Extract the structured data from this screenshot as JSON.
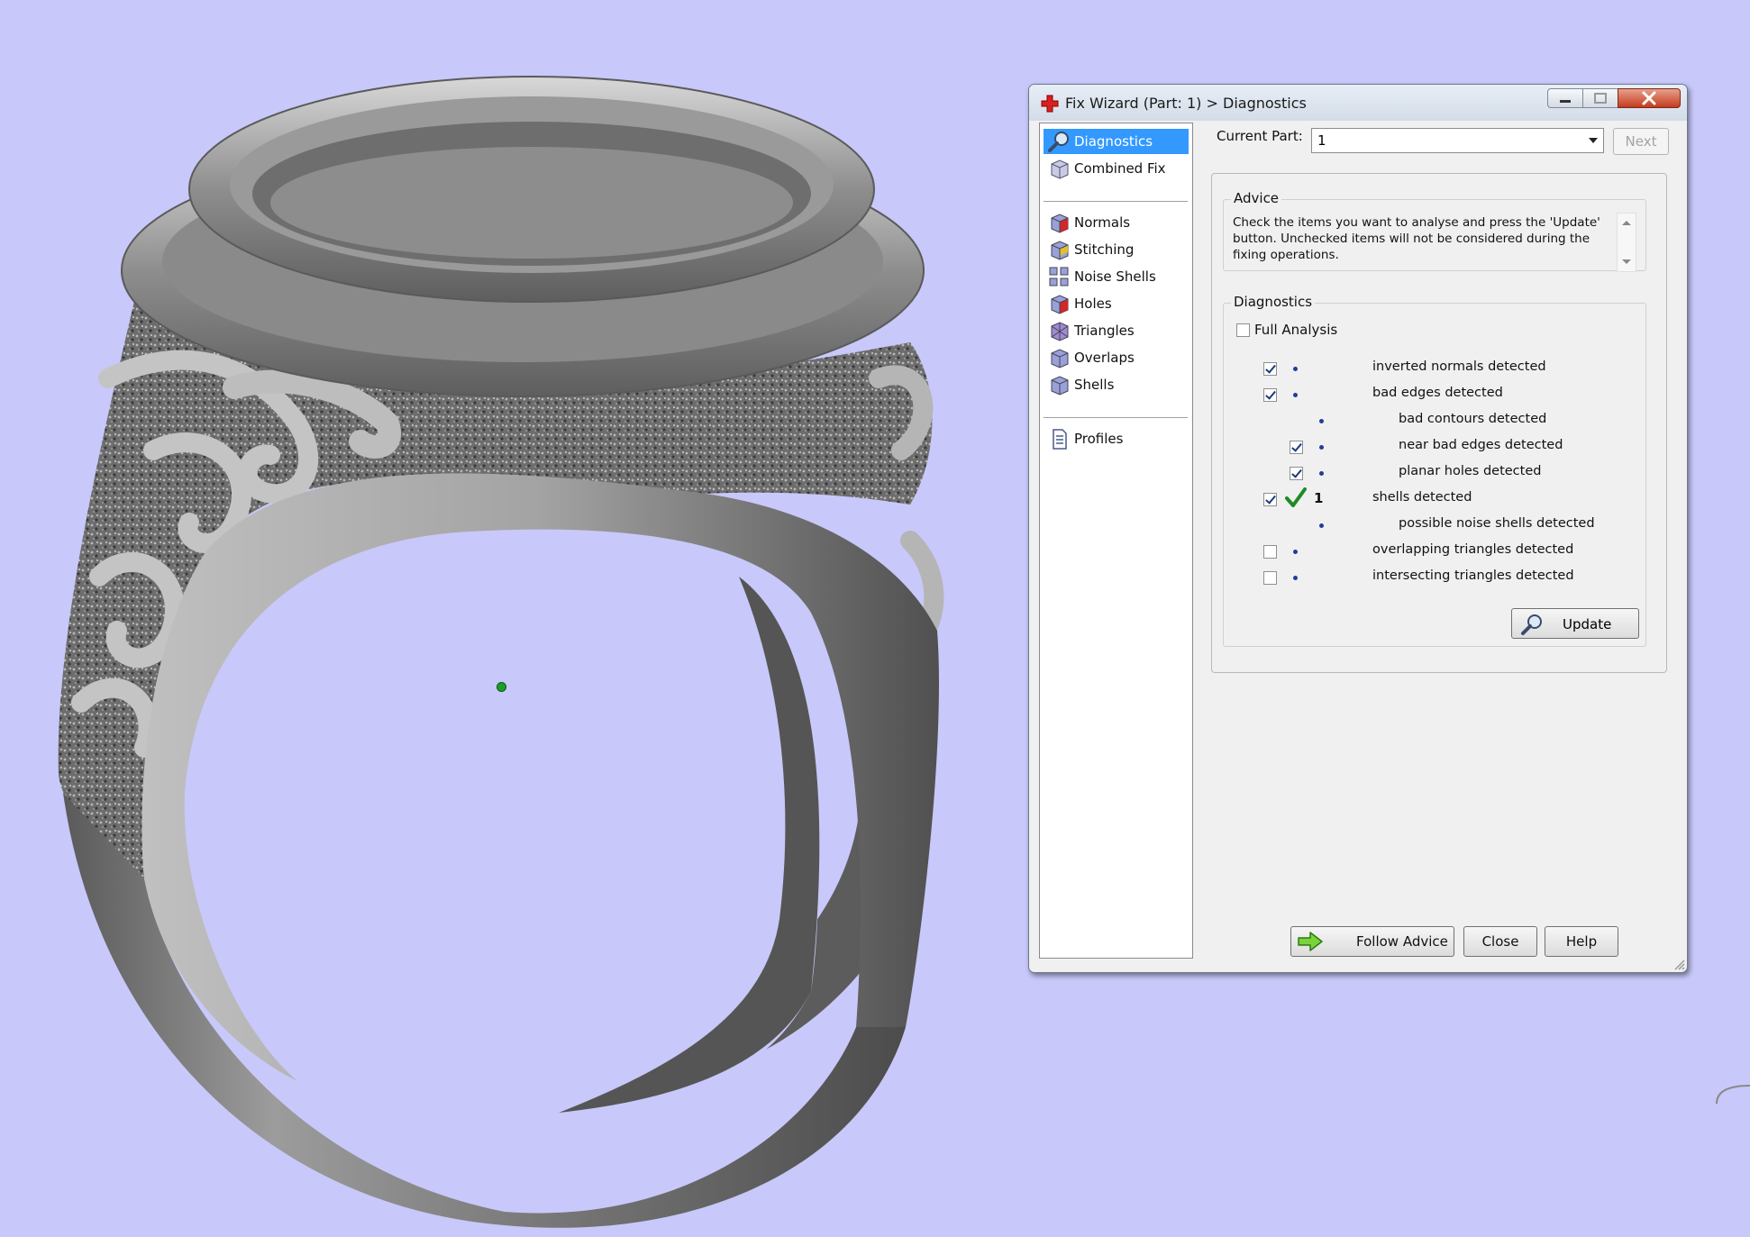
{
  "dialog": {
    "title": "Fix Wizard (Part: 1) > Diagnostics",
    "current_part_label": "Current Part:",
    "current_part_value": "1",
    "next_label": "Next"
  },
  "nav": {
    "items": [
      {
        "label": "Diagnostics",
        "selected": true,
        "icon": "magnifier-icon"
      },
      {
        "label": "Combined Fix",
        "icon": "cube-icon"
      },
      {
        "label": "Normals",
        "icon": "normals-cube-icon"
      },
      {
        "label": "Stitching",
        "icon": "stitching-cube-icon"
      },
      {
        "label": "Noise Shells",
        "icon": "noise-shells-icon"
      },
      {
        "label": "Holes",
        "icon": "holes-cube-icon"
      },
      {
        "label": "Triangles",
        "icon": "triangles-cube-icon"
      },
      {
        "label": "Overlaps",
        "icon": "overlaps-cube-icon"
      },
      {
        "label": "Shells",
        "icon": "shells-cube-icon"
      },
      {
        "label": "Profiles",
        "icon": "document-icon"
      }
    ]
  },
  "advice": {
    "title": "Advice",
    "text": "Check the items you want to analyse and press the 'Update' button. Unchecked items will not be considered during the fixing operations."
  },
  "diagnostics": {
    "title": "Diagnostics",
    "full_analysis_label": "Full Analysis",
    "full_analysis_checked": false,
    "rows": [
      {
        "label": "inverted normals detected",
        "checked": true,
        "level": 0
      },
      {
        "label": "bad edges detected",
        "checked": true,
        "level": 0
      },
      {
        "label": "bad contours detected",
        "checked": null,
        "level": 1
      },
      {
        "label": "near bad edges detected",
        "checked": true,
        "level": 1
      },
      {
        "label": "planar holes detected",
        "checked": true,
        "level": 1
      },
      {
        "label": "shells detected",
        "checked": true,
        "level": 0,
        "count": "1",
        "ok": true
      },
      {
        "label": "possible noise shells detected",
        "checked": null,
        "level": 1
      },
      {
        "label": "overlapping triangles detected",
        "checked": false,
        "level": 0
      },
      {
        "label": "intersecting triangles detected",
        "checked": false,
        "level": 0
      }
    ],
    "update_label": "Update"
  },
  "buttons": {
    "follow_advice": "Follow Advice",
    "close": "Close",
    "help": "Help"
  },
  "colors": {
    "viewport_bg": "#c8c8fa",
    "selection": "#3399ff",
    "ring_metal": "#8c8c8c"
  }
}
